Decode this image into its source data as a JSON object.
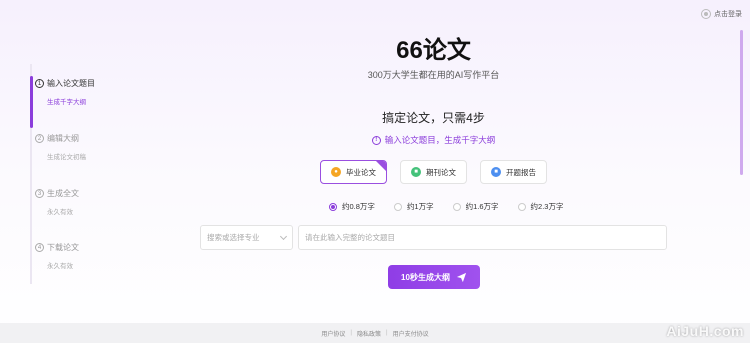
{
  "header": {
    "login_label": "点击登录",
    "login_icon": "user-icon"
  },
  "steps": [
    {
      "num": "1",
      "title": "输入论文题目",
      "sub": "生成千字大纲"
    },
    {
      "num": "2",
      "title": "编辑大纲",
      "sub": "生成论文初稿"
    },
    {
      "num": "3",
      "title": "生成全文",
      "sub": "永久有效"
    },
    {
      "num": "4",
      "title": "下载论文",
      "sub": "永久有效"
    }
  ],
  "main": {
    "title": "66论文",
    "subtitle": "300万大学生都在用的AI写作平台",
    "heading": "搞定论文，只需4步",
    "hint": "输入论文题目，生成千字大纲"
  },
  "paper_types": [
    {
      "label": "毕业论文",
      "icon": "graduation-icon",
      "selected": true
    },
    {
      "label": "期刊论文",
      "icon": "journal-icon",
      "selected": false
    },
    {
      "label": "开题报告",
      "icon": "report-icon",
      "selected": false
    }
  ],
  "word_counts": [
    {
      "label": "约0.8万字",
      "checked": true
    },
    {
      "label": "约1万字",
      "checked": false
    },
    {
      "label": "约1.6万字",
      "checked": false
    },
    {
      "label": "约2.3万字",
      "checked": false
    }
  ],
  "form": {
    "major_placeholder": "搜索或选择专业",
    "title_placeholder": "请在此输入完整的论文题目",
    "title_value": "",
    "generate_label": "10秒生成大纲"
  },
  "footer": {
    "links": [
      "用户协议",
      "隐私政策",
      "用户支付协议"
    ]
  },
  "watermark": "AiJuH.com",
  "colors": {
    "accent": "#8b3ddb"
  }
}
